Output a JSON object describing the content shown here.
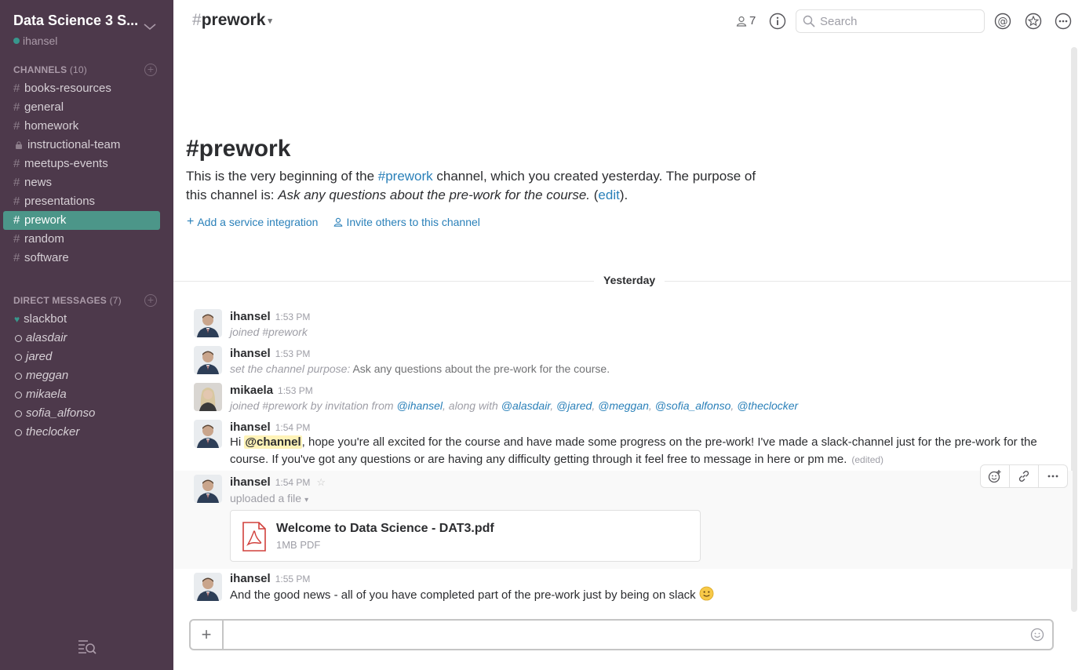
{
  "workspace": {
    "name": "Data Science 3 S...",
    "user": "ihansel"
  },
  "sidebar": {
    "channels_heading": "CHANNELS",
    "channels_count": "(10)",
    "channels": [
      {
        "label": "books-resources",
        "prefix": "#"
      },
      {
        "label": "general",
        "prefix": "#"
      },
      {
        "label": "homework",
        "prefix": "#"
      },
      {
        "label": "instructional-team",
        "prefix": "lock"
      },
      {
        "label": "meetups-events",
        "prefix": "#"
      },
      {
        "label": "news",
        "prefix": "#"
      },
      {
        "label": "presentations",
        "prefix": "#"
      },
      {
        "label": "prework",
        "prefix": "#",
        "active": true
      },
      {
        "label": "random",
        "prefix": "#"
      },
      {
        "label": "software",
        "prefix": "#"
      }
    ],
    "dm_heading": "DIRECT MESSAGES",
    "dm_count": "(7)",
    "dms": [
      {
        "label": "slackbot",
        "status": "heart"
      },
      {
        "label": "alasdair",
        "status": "away"
      },
      {
        "label": "jared",
        "status": "away"
      },
      {
        "label": "meggan",
        "status": "away"
      },
      {
        "label": "mikaela",
        "status": "away"
      },
      {
        "label": "sofia_alfonso",
        "status": "away"
      },
      {
        "label": "theclocker",
        "status": "away"
      }
    ]
  },
  "header": {
    "hash": "#",
    "channel": "prework",
    "member_count": "7",
    "search_placeholder": "Search"
  },
  "intro": {
    "title": "#prework",
    "text_1": "This is the very beginning of the ",
    "channel_link": "#prework",
    "text_2": " channel, which you created yesterday. The purpose of this channel is: ",
    "purpose": "Ask any questions about the pre-work for the course.",
    "text_3": " (",
    "edit_link": "edit",
    "text_4": ").",
    "add_integration": "Add a service integration",
    "invite_others": "Invite others to this channel"
  },
  "day_divider": "Yesterday",
  "messages": [
    {
      "name": "ihansel",
      "time": "1:53 PM",
      "body": "joined #prework"
    },
    {
      "name": "ihansel",
      "time": "1:53 PM",
      "sys_label": "set the channel purpose:",
      "body": " Ask any questions about the pre-work for the course."
    },
    {
      "name": "mikaela",
      "time": "1:53 PM",
      "body_pre": "joined #prework by invitation from ",
      "mentions": [
        "@ihansel",
        "@alasdair",
        "@jared",
        "@meggan",
        "@sofia_alfonso",
        "@theclocker"
      ],
      "along_with": ", along with "
    },
    {
      "name": "ihansel",
      "time": "1:54 PM",
      "hi": "Hi ",
      "channel_mention": "@channel",
      "body": ", hope you're all excited for the course and have made some progress on the pre-work! I've made a slack-channel just for the pre-work for the course. If you've got any questions or are having any difficulty getting through it feel free to message in here or pm me.",
      "edited": "(edited)"
    },
    {
      "name": "ihansel",
      "time": "1:54 PM",
      "body": "uploaded a file",
      "file_name": "Welcome to Data Science - DAT3.pdf",
      "file_meta": "1MB PDF"
    },
    {
      "name": "ihansel",
      "time": "1:55 PM",
      "body": "And the good news - all of you have completed part of the pre-work just by being on slack"
    }
  ],
  "composer": {
    "value": ""
  },
  "colors": {
    "sidebar": "#4d394b",
    "active": "#4c9689",
    "link": "#2a80b9",
    "mention_bg": "#fff3b8"
  }
}
